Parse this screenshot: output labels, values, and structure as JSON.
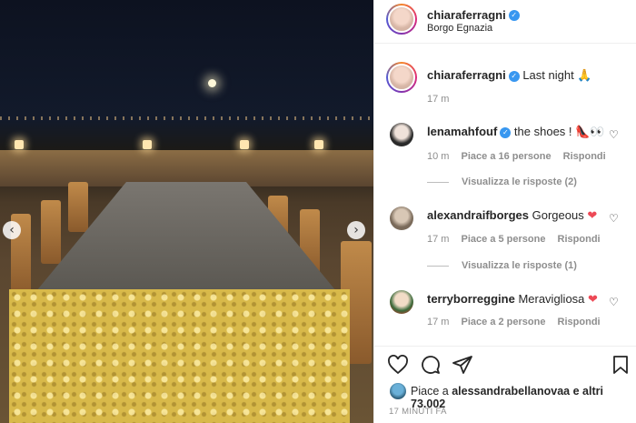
{
  "post": {
    "author": "chiaraferragni",
    "location": "Borgo Egnazia",
    "caption": "Last night",
    "caption_emoji": "🙏",
    "caption_time": "17 m"
  },
  "comments": [
    {
      "username": "lenamahfouf",
      "verified": true,
      "text": "the shoes !",
      "emoji": "👠👀",
      "time": "10 m",
      "likes": "Piace a 16 persone",
      "reply": "Rispondi",
      "view_replies": "Visualizza le risposte (2)"
    },
    {
      "username": "alexandraifborges",
      "verified": false,
      "text": "Gorgeous",
      "emoji": "❤",
      "time": "17 m",
      "likes": "Piace a 5 persone",
      "reply": "Rispondi",
      "view_replies": "Visualizza le risposte (1)"
    },
    {
      "username": "terryborreggine",
      "verified": false,
      "text": "Meravigliosa",
      "emoji": "❤",
      "time": "17 m",
      "likes": "Piace a 2 persone",
      "reply": "Rispondi"
    }
  ],
  "likes": {
    "prefix": "Piace a",
    "user": "alessandrabellanovaa",
    "suffix": "e altri 73.002"
  },
  "timestamp": "17 MINUTI FA",
  "icons": {
    "verified": "verified-badge-icon",
    "like": "heart-icon",
    "comment": "comment-icon",
    "share": "paper-plane-icon",
    "save": "bookmark-icon",
    "prev": "chevron-left-icon",
    "next": "chevron-right-icon"
  },
  "colors": {
    "verified": "#3897f0",
    "heart": "#ed4956",
    "muted": "#8e8e8e"
  }
}
